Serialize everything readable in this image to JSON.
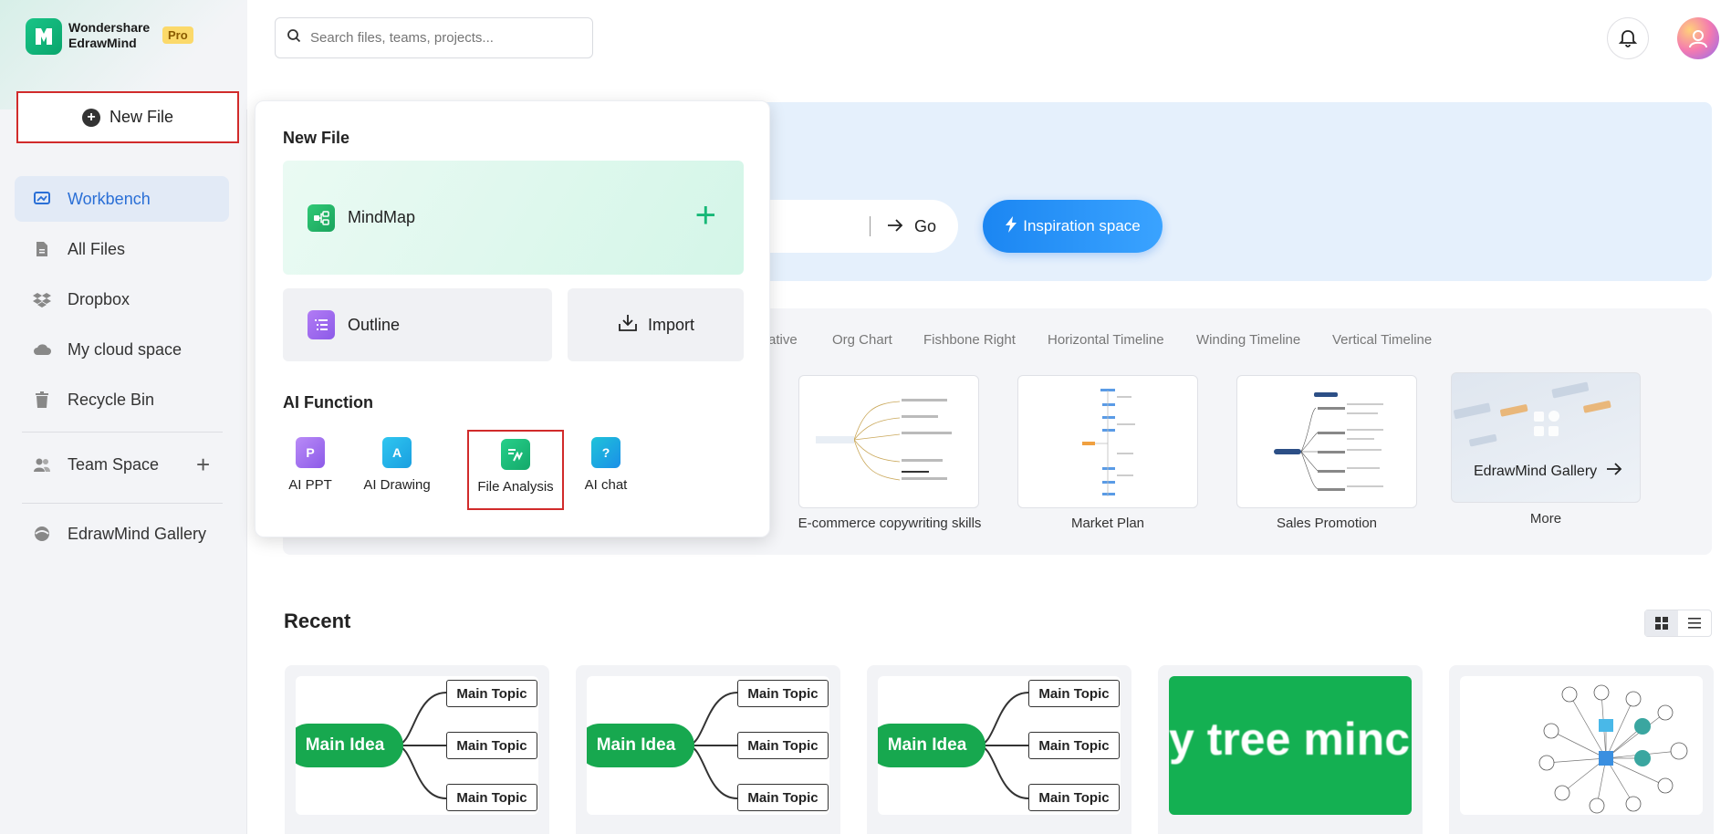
{
  "brand": {
    "line1": "Wondershare",
    "line2": "EdrawMind",
    "badge": "Pro"
  },
  "sidebar": {
    "new_file": "New File",
    "items": [
      {
        "label": "Workbench",
        "icon": "workbench-icon"
      },
      {
        "label": "All Files",
        "icon": "file-icon"
      },
      {
        "label": "Dropbox",
        "icon": "dropbox-icon"
      },
      {
        "label": "My cloud space",
        "icon": "cloud-icon"
      },
      {
        "label": "Recycle Bin",
        "icon": "trash-icon"
      }
    ],
    "team_space": "Team Space",
    "gallery": "EdrawMind Gallery"
  },
  "search": {
    "placeholder": "Search files, teams, projects..."
  },
  "banner": {
    "go": "Go",
    "inspiration": "Inspiration space"
  },
  "templates": {
    "categories": [
      "ative",
      "Org Chart",
      "Fishbone Right",
      "Horizontal Timeline",
      "Winding Timeline",
      "Vertical Timeline"
    ],
    "cards": [
      "E-commerce copywriting skills",
      "Market Plan",
      "Sales Promotion"
    ],
    "gallery_card": "EdrawMind Gallery",
    "more": "More"
  },
  "recent": {
    "title": "Recent",
    "main_idea": "Main Idea",
    "main_topic": "Main Topic",
    "tree_text": "y tree minc"
  },
  "popup": {
    "new_file_heading": "New File",
    "mindmap": "MindMap",
    "outline": "Outline",
    "import": "Import",
    "ai_heading": "AI Function",
    "ai_items": [
      {
        "label": "AI PPT",
        "icon": "ai-ppt-icon",
        "color": "#a56bf2"
      },
      {
        "label": "AI Drawing",
        "icon": "ai-drawing-icon",
        "color": "#19b8e6"
      },
      {
        "label": "File Analysis",
        "icon": "file-analysis-icon",
        "color": "#19c47e"
      },
      {
        "label": "AI chat",
        "icon": "ai-chat-icon",
        "color": "#1ab0e8"
      }
    ]
  }
}
